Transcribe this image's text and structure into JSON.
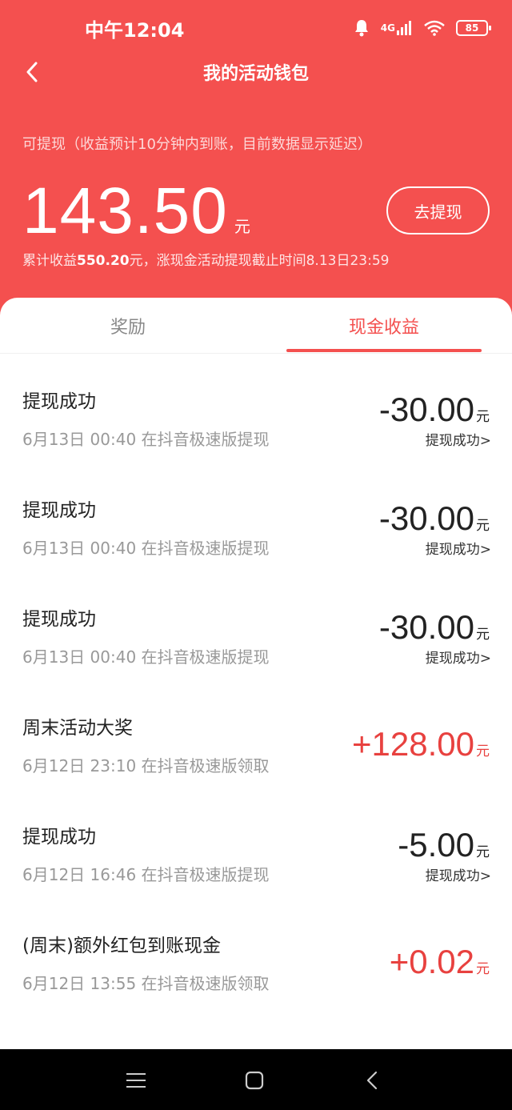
{
  "status_bar": {
    "time": "中午12:04",
    "network": "4G",
    "battery": "85"
  },
  "nav": {
    "title": "我的活动钱包"
  },
  "wallet": {
    "note": "可提现（收益预计10分钟内到账，目前数据显示延迟）",
    "balance": "143.50",
    "unit": "元",
    "withdraw_label": "去提现",
    "total_prefix": "累计收益",
    "total_value": "550.20",
    "total_suffix": "元，涨现金活动提现截止时间8.13日23:59"
  },
  "tabs": [
    {
      "label": "奖励",
      "active": false
    },
    {
      "label": "现金收益",
      "active": true
    }
  ],
  "items": [
    {
      "title": "提现成功",
      "sub": "6月13日 00:40 在抖音极速版提现",
      "amount": "-30.00",
      "unit": "元",
      "status": "提现成功>"
    },
    {
      "title": "提现成功",
      "sub": "6月13日 00:40 在抖音极速版提现",
      "amount": "-30.00",
      "unit": "元",
      "status": "提现成功>"
    },
    {
      "title": "提现成功",
      "sub": "6月13日 00:40 在抖音极速版提现",
      "amount": "-30.00",
      "unit": "元",
      "status": "提现成功>"
    },
    {
      "title": "周末活动大奖",
      "sub": "6月12日 23:10 在抖音极速版领取",
      "amount": "+128.00",
      "unit": "元",
      "status": ""
    },
    {
      "title": "提现成功",
      "sub": "6月12日 16:46 在抖音极速版提现",
      "amount": "-5.00",
      "unit": "元",
      "status": "提现成功>"
    },
    {
      "title": "(周末)额外红包到账现金",
      "sub": "6月12日 13:55 在抖音极速版领取",
      "amount": "+0.02",
      "unit": "元",
      "status": ""
    }
  ],
  "colors": {
    "brand": "#f4504f",
    "positive": "#e8413f"
  },
  "icons": {
    "back": "chevron-left-icon",
    "menu": "menu-icon",
    "home": "home-square-icon",
    "nav_back": "triangle-back-icon"
  }
}
